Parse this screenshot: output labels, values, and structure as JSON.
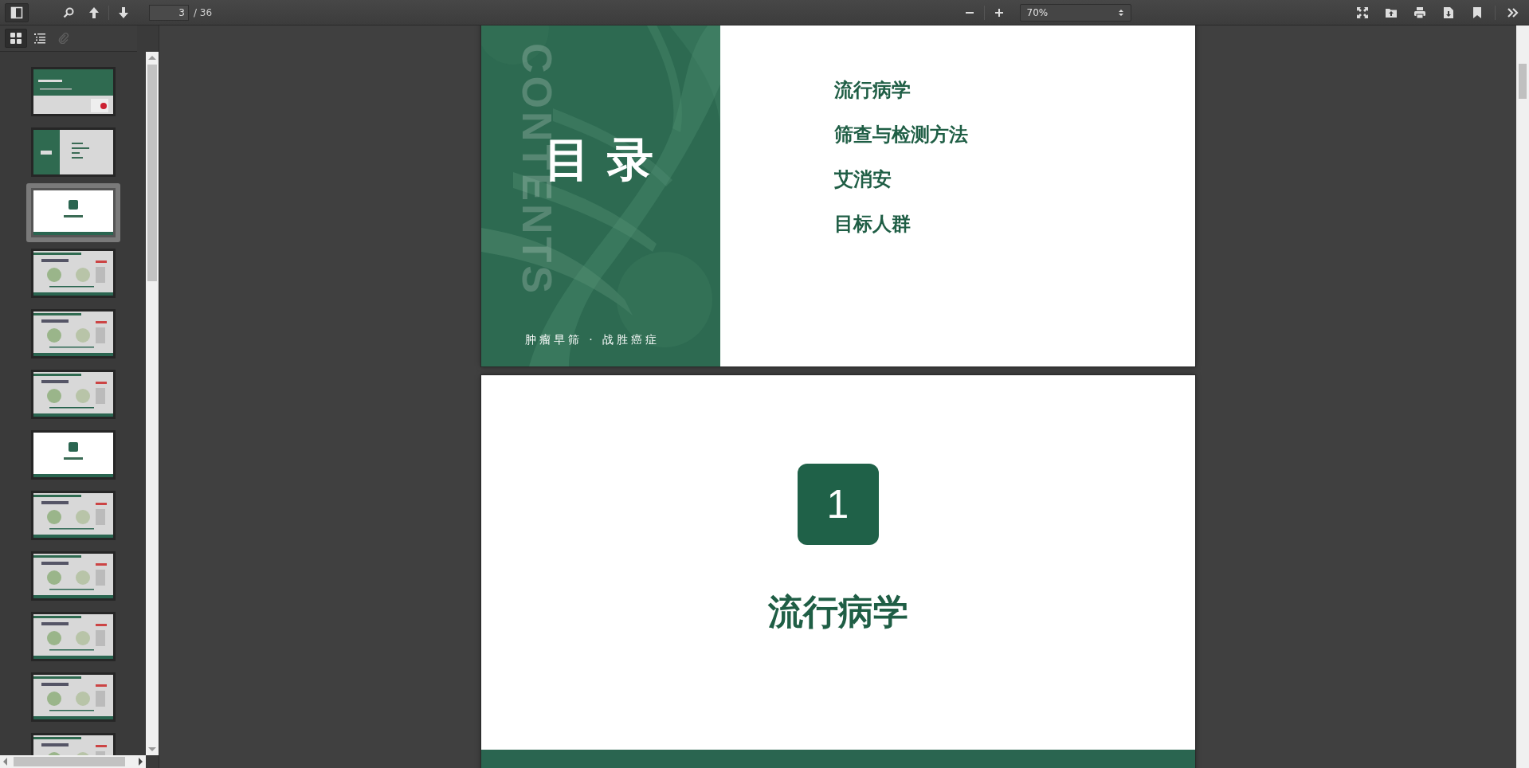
{
  "toolbar": {
    "page_number": {
      "value": "3"
    },
    "page_count": "/ 36",
    "zoom": {
      "value": "70%"
    }
  },
  "sidebar": {
    "views": [
      {
        "kind": "thumbnails",
        "selected": true,
        "disabled": false
      },
      {
        "kind": "outline",
        "selected": false,
        "disabled": false
      },
      {
        "kind": "attachments",
        "selected": false,
        "disabled": true
      }
    ],
    "thumbnails": [
      {
        "kind": "cover",
        "selected": false
      },
      {
        "kind": "contents",
        "selected": false
      },
      {
        "kind": "section",
        "selected": true
      },
      {
        "kind": "content",
        "selected": false
      },
      {
        "kind": "content",
        "selected": false
      },
      {
        "kind": "content",
        "selected": false
      },
      {
        "kind": "section",
        "selected": false
      },
      {
        "kind": "content",
        "selected": false
      },
      {
        "kind": "content",
        "selected": false
      },
      {
        "kind": "content",
        "selected": false
      },
      {
        "kind": "content",
        "selected": false
      },
      {
        "kind": "content",
        "selected": false
      }
    ]
  },
  "pages": [
    {
      "kind": "contents",
      "title": "目 录",
      "vertical_text": "CONTENTS",
      "slogan": "肿瘤早筛 · 战胜癌症",
      "items": [
        "流行病学",
        "筛查与检测方法",
        "艾消安",
        "目标人群"
      ]
    },
    {
      "kind": "section",
      "number": "1",
      "title": "流行病学"
    }
  ]
}
